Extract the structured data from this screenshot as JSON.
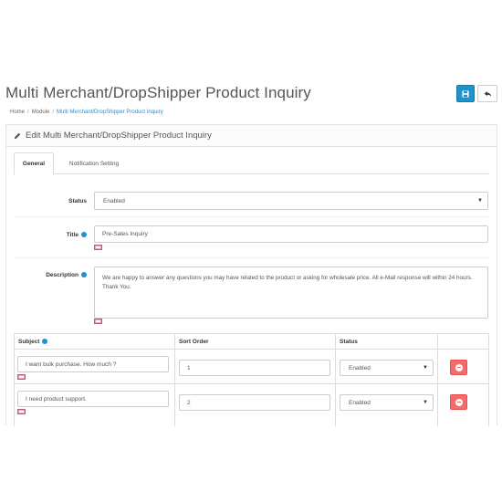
{
  "header": {
    "title": "Multi Merchant/DropShipper Product Inquiry",
    "save_icon": "save-icon",
    "back_icon": "reply-icon"
  },
  "breadcrumb": {
    "items": [
      "Home",
      "Module",
      "Multi Merchant/DropShipper Product Inquiry"
    ]
  },
  "panel": {
    "heading": "Edit Multi Merchant/DropShipper Product Inquiry",
    "tabs": [
      {
        "label": "General",
        "active": true
      },
      {
        "label": "Notification Setting",
        "active": false
      }
    ]
  },
  "form": {
    "status": {
      "label": "Status",
      "value": "Enabled"
    },
    "title": {
      "label": "Title",
      "value": "Pre-Sales Inquiry"
    },
    "description": {
      "label": "Description",
      "value": "We are happy to answer any questions you may have related to the product or asking for wholesale price. All e-Mail response will within 24 hours. Thank You."
    }
  },
  "subjects_table": {
    "headers": [
      "Subject",
      "Sort Order",
      "Status"
    ],
    "rows": [
      {
        "subject": "I want bulk purchase. How much ?",
        "sort_order": "1",
        "status": "Enabled"
      },
      {
        "subject": "I need product support.",
        "sort_order": "2",
        "status": "Enabled"
      }
    ]
  },
  "colors": {
    "primary": "#1e91cf",
    "danger": "#f56b6b"
  }
}
